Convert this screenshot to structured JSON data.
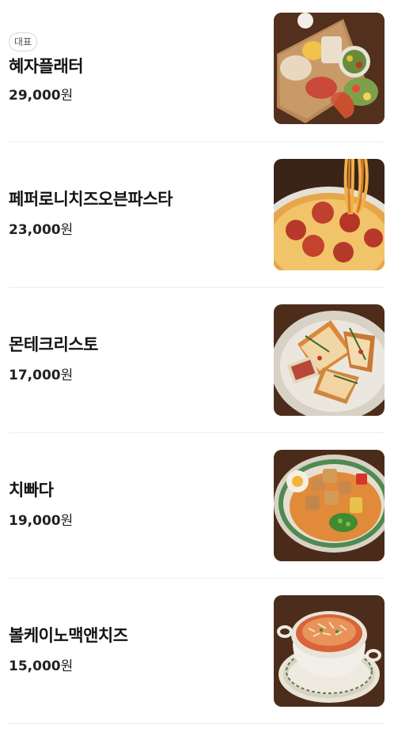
{
  "menu": {
    "items": [
      {
        "badge": "대표",
        "name": "혜자플래터",
        "price": "29,000",
        "currency": "원",
        "photo_icon": "platter-food-photo-icon"
      },
      {
        "name": "페퍼로니치즈오븐파스타",
        "price": "23,000",
        "currency": "원",
        "photo_icon": "oven-pasta-food-photo-icon"
      },
      {
        "name": "몬테크리스토",
        "price": "17,000",
        "currency": "원",
        "photo_icon": "monte-cristo-food-photo-icon"
      },
      {
        "name": "치빠다",
        "price": "19,000",
        "currency": "원",
        "photo_icon": "chicken-dish-food-photo-icon"
      },
      {
        "name": "볼케이노맥앤치즈",
        "price": "15,000",
        "currency": "원",
        "photo_icon": "mac-and-cheese-food-photo-icon"
      }
    ]
  },
  "colors": {
    "text": "#141414",
    "divider": "#ededed",
    "badge_border": "#d6d6d6",
    "wood": "#4a2a18"
  }
}
